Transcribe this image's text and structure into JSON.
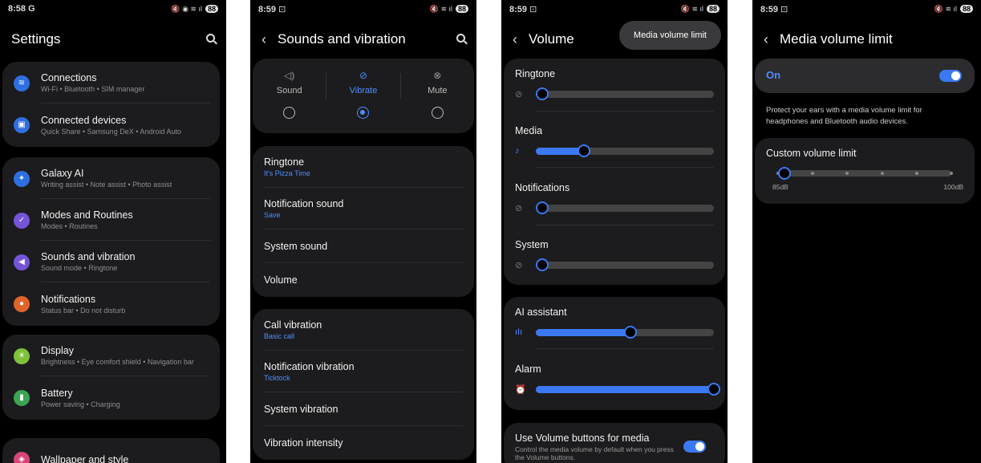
{
  "screens": {
    "settings": {
      "status": {
        "time": "8:58",
        "extra": "G",
        "battery": "88"
      },
      "title": "Settings",
      "groups": [
        [
          {
            "title": "Connections",
            "sub": "Wi-Fi  •  Bluetooth  •  SIM manager",
            "color": "#2f6fe0",
            "icon": "wifi-icon"
          },
          {
            "title": "Connected devices",
            "sub": "Quick Share  •  Samsung DeX  •  Android Auto",
            "color": "#2f6fe0",
            "icon": "devices-icon"
          }
        ],
        [
          {
            "title": "Galaxy AI",
            "sub": "Writing assist  •  Note assist  •  Photo assist",
            "color": "#2f6fe0",
            "icon": "sparkle-icon"
          },
          {
            "title": "Modes and Routines",
            "sub": "Modes  •  Routines",
            "color": "#7654d8",
            "icon": "check-circle-icon"
          },
          {
            "title": "Sounds and vibration",
            "sub": "Sound mode  •  Ringtone",
            "color": "#7654d8",
            "icon": "speaker-icon"
          },
          {
            "title": "Notifications",
            "sub": "Status bar  •  Do not disturb",
            "color": "#e0642a",
            "icon": "bell-icon"
          }
        ],
        [
          {
            "title": "Display",
            "sub": "Brightness  •  Eye comfort shield  •  Navigation bar",
            "color": "#7fc23a",
            "icon": "sun-icon"
          },
          {
            "title": "Battery",
            "sub": "Power saving  •  Charging",
            "color": "#3aa552",
            "icon": "battery-icon"
          }
        ],
        [
          {
            "title": "Wallpaper and style",
            "sub": "",
            "color": "#d8457a",
            "icon": "palette-icon"
          }
        ]
      ]
    },
    "sounds": {
      "status": {
        "time": "8:59",
        "battery": "88"
      },
      "title": "Sounds and vibration",
      "modes": [
        {
          "label": "Sound",
          "icon": "sound-icon"
        },
        {
          "label": "Vibrate",
          "icon": "vibrate-icon"
        },
        {
          "label": "Mute",
          "icon": "mute-icon"
        }
      ],
      "selected_mode": "Vibrate",
      "group1": [
        {
          "title": "Ringtone",
          "sub": "It's Pizza Time"
        },
        {
          "title": "Notification sound",
          "sub": "Save"
        },
        {
          "title": "System sound",
          "sub": ""
        },
        {
          "title": "Volume",
          "sub": ""
        }
      ],
      "group2": [
        {
          "title": "Call vibration",
          "sub": "Basic call"
        },
        {
          "title": "Notification vibration",
          "sub": "Ticktock"
        },
        {
          "title": "System vibration",
          "sub": ""
        },
        {
          "title": "Vibration intensity",
          "sub": ""
        }
      ]
    },
    "volume": {
      "status": {
        "time": "8:59",
        "battery": "88"
      },
      "title": "Volume",
      "tooltip": "Media volume limit",
      "sliders": [
        {
          "label": "Ringtone",
          "value": 0,
          "icon": "vibrate-icon",
          "muted": true
        },
        {
          "label": "Media",
          "value": 0.27,
          "icon": "music-icon",
          "muted": false
        },
        {
          "label": "Notifications",
          "value": 0,
          "icon": "notification-off-icon",
          "muted": true
        },
        {
          "label": "System",
          "value": 0,
          "icon": "system-off-icon",
          "muted": true
        },
        {
          "label": "AI assistant",
          "value": 0.53,
          "icon": "assistant-icon",
          "muted": false
        },
        {
          "label": "Alarm",
          "value": 1.0,
          "icon": "alarm-icon",
          "muted": false
        }
      ],
      "use_buttons": {
        "title": "Use Volume buttons for media",
        "sub": "Control the media volume by default when you press the Volume buttons.",
        "on": true
      }
    },
    "limit": {
      "status": {
        "time": "8:59",
        "battery": "88"
      },
      "title": "Media volume limit",
      "switch_label": "On",
      "switch_on": true,
      "description": "Protect your ears with a media volume limit for headphones and Bluetooth audio devices.",
      "custom_label": "Custom volume limit",
      "min_label": "85dB",
      "max_label": "100dB",
      "steps": 6,
      "value_step": 0
    }
  },
  "colors": {
    "accent": "#3b79f2",
    "card": "#1c1c1e",
    "bg": "#000000"
  }
}
